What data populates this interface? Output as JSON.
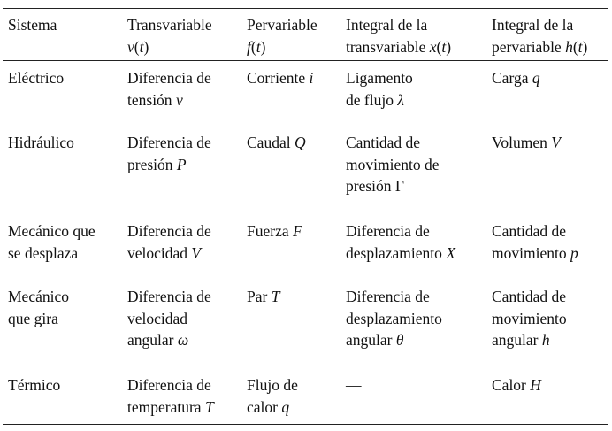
{
  "header": {
    "sistema": "Sistema",
    "transvariable": "Transvariable",
    "transvariable_sym": "v",
    "pervariable": "Pervariable",
    "pervariable_sym": "f",
    "int_trans_line1": "Integral de la",
    "int_trans_line2": "transvariable",
    "int_trans_sym": "x",
    "int_perv_line1": "Integral de la",
    "int_perv_line2": "pervariable",
    "int_perv_sym": "h",
    "time_var": "t"
  },
  "rows": [
    {
      "sistema": [
        "Eléctrico"
      ],
      "trans": [
        "Diferencia de",
        "tensión"
      ],
      "trans_sym": "v",
      "perv": "Corriente",
      "perv_sym": "i",
      "int_trans": [
        "Ligamento",
        "de flujo"
      ],
      "int_trans_sym": "λ",
      "int_perv": "Carga",
      "int_perv_sym": "q"
    },
    {
      "sistema": [
        "Hidráulico"
      ],
      "trans": [
        "Diferencia de",
        "presión"
      ],
      "trans_sym": "P",
      "perv": "Caudal",
      "perv_sym": "Q",
      "int_trans": [
        "Cantidad de",
        "movimiento de",
        "presión"
      ],
      "int_trans_sym": "Γ",
      "int_perv": "Volumen",
      "int_perv_sym": "V"
    },
    {
      "sistema": [
        "Mecánico que",
        "se desplaza"
      ],
      "trans": [
        "Diferencia de",
        "velocidad"
      ],
      "trans_sym": "V",
      "perv": "Fuerza",
      "perv_sym": "F",
      "int_trans": [
        "Diferencia de",
        "desplazamiento"
      ],
      "int_trans_sym": "X",
      "int_perv": [
        "Cantidad de",
        "movimiento"
      ],
      "int_perv_sym": "p"
    },
    {
      "sistema": [
        "Mecánico",
        "que gira"
      ],
      "trans": [
        "Diferencia de",
        "velocidad",
        "angular"
      ],
      "trans_sym": "ω",
      "perv": "Par",
      "perv_sym": "T",
      "int_trans": [
        "Diferencia de",
        "desplazamiento",
        "angular"
      ],
      "int_trans_sym": "θ",
      "int_perv": [
        "Cantidad de",
        "movimiento",
        "angular"
      ],
      "int_perv_sym": "h"
    },
    {
      "sistema": [
        "Térmico"
      ],
      "trans": [
        "Diferencia de",
        "temperatura"
      ],
      "trans_sym": "T",
      "perv": [
        "Flujo de",
        "calor"
      ],
      "perv_sym": "q",
      "int_trans_dash": "—",
      "int_perv": "Calor",
      "int_perv_sym": "H"
    }
  ]
}
